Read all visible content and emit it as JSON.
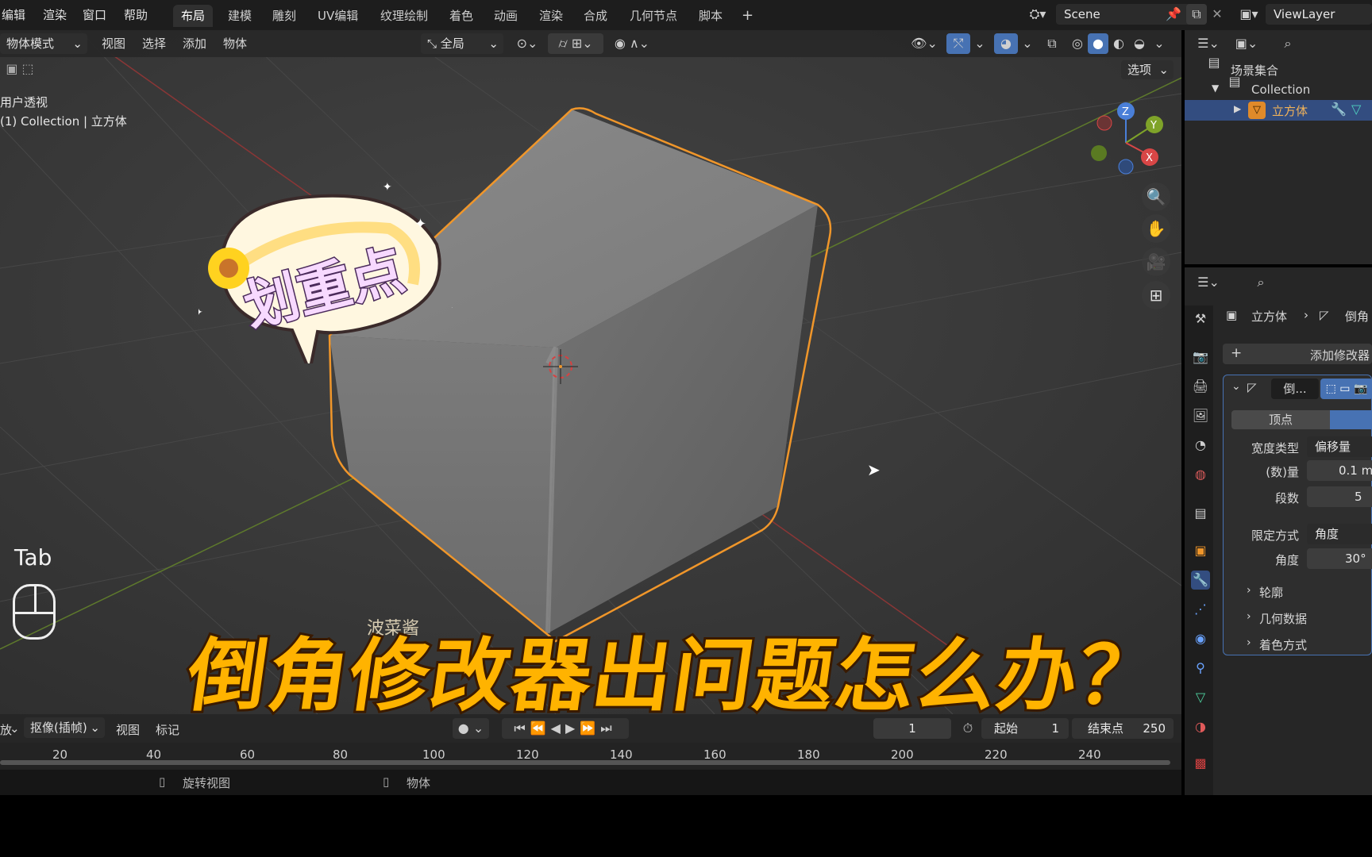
{
  "menubar": {
    "items": [
      "编辑",
      "渲染",
      "窗口",
      "帮助"
    ],
    "workspaces": [
      "布局",
      "建模",
      "雕刻",
      "UV编辑",
      "纹理绘制",
      "着色",
      "动画",
      "渲染",
      "合成",
      "几何节点",
      "脚本"
    ],
    "active_workspace": "布局",
    "add_tab": "+",
    "scene_label": "Scene",
    "viewlayer_label": "ViewLayer"
  },
  "viewport_header": {
    "mode": "物体模式",
    "menus": [
      "视图",
      "选择",
      "添加",
      "物体"
    ],
    "transform_orientation": "全局",
    "options": "选项"
  },
  "viewport": {
    "view_name": "用户透视",
    "collection_info": "(1) Collection | 立方体",
    "key_hint": "Tab",
    "gizmo_axes": {
      "x": "X",
      "y": "Y",
      "z": "Z"
    },
    "watermark": "波菜酱"
  },
  "overlay": {
    "sticker": "划重点",
    "title": "倒角修改器出问题怎么办？"
  },
  "outliner": {
    "scene_collection": "场景集合",
    "collection": "Collection",
    "object": "立方体"
  },
  "properties": {
    "breadcrumb_object": "立方体",
    "breadcrumb_modifier": "倒角",
    "add_modifier": "添加修改器",
    "modifier_name": "倒...",
    "affect_vertices": "顶点",
    "rows": [
      {
        "label": "宽度类型",
        "value": "偏移量"
      },
      {
        "label": "(数)量",
        "value": "0.1 m"
      },
      {
        "label": "段数",
        "value": "5"
      },
      {
        "label": "限定方式",
        "value": "角度"
      },
      {
        "label": "角度",
        "value": "30°"
      }
    ],
    "panels": [
      "轮廓",
      "几何数据",
      "着色方式"
    ]
  },
  "timeline": {
    "playback": "放",
    "keying": "抠像(插帧)",
    "menus": [
      "视图",
      "标记"
    ],
    "current_frame": "1",
    "start_label": "起始",
    "start_value": "1",
    "end_label": "结束点",
    "end_value": "250",
    "ticks": [
      "20",
      "40",
      "60",
      "80",
      "100",
      "120",
      "140",
      "160",
      "180",
      "200",
      "220",
      "240"
    ]
  },
  "statusbar": {
    "rotate": "旋转视图",
    "object": "物体"
  },
  "colors": {
    "accent_blue": "#4772b3",
    "selection_orange": "#f0962a",
    "title_yellow": "#ffb300"
  }
}
